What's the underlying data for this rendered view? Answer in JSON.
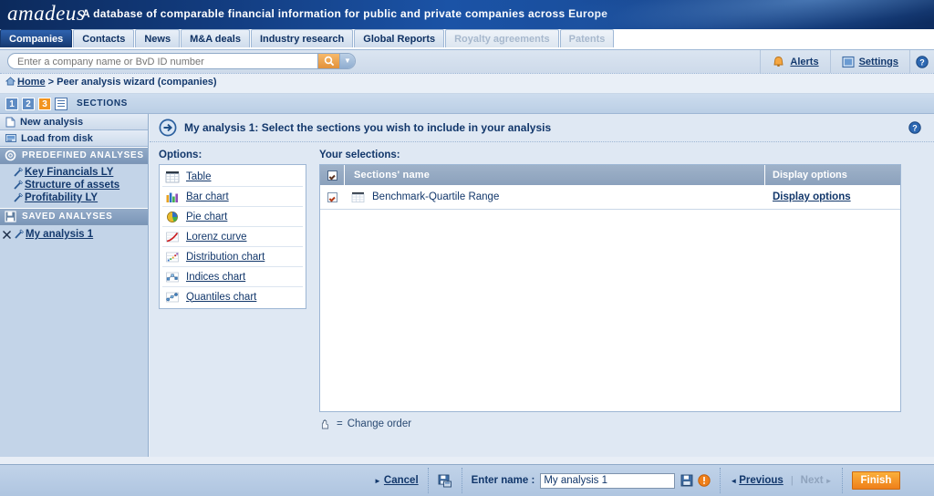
{
  "banner": {
    "logo": "amadeus",
    "tagline": "A database of comparable financial information for public and private companies across Europe"
  },
  "tabs": [
    {
      "label": "Companies",
      "state": "active"
    },
    {
      "label": "Contacts",
      "state": "normal"
    },
    {
      "label": "News",
      "state": "normal"
    },
    {
      "label": "M&A deals",
      "state": "normal"
    },
    {
      "label": "Industry research",
      "state": "normal"
    },
    {
      "label": "Global Reports",
      "state": "normal"
    },
    {
      "label": "Royalty agreements",
      "state": "disabled"
    },
    {
      "label": "Patents",
      "state": "disabled"
    }
  ],
  "search": {
    "placeholder": "Enter a company name or BvD ID number",
    "value": "",
    "go_icon": "search-icon",
    "caret_icon": "chevron-down-icon"
  },
  "topright": {
    "alerts_label": "Alerts",
    "alerts_icon": "bell-icon",
    "settings_label": "Settings",
    "settings_icon": "settings-icon",
    "help_icon": "help-icon"
  },
  "breadcrumb": {
    "home_icon": "home-icon",
    "home": "Home",
    "separator": ">",
    "current": "Peer analysis wizard (companies)"
  },
  "steps": {
    "items": [
      {
        "label": "1",
        "state": "done"
      },
      {
        "label": "2",
        "state": "done"
      },
      {
        "label": "3",
        "state": "current"
      }
    ],
    "doc_icon": "document-icon",
    "label": "SECTIONS"
  },
  "sidebar": {
    "buttons": [
      {
        "label": "New analysis",
        "icon": "page-icon"
      },
      {
        "label": "Load from disk",
        "icon": "disk-drive-icon"
      }
    ],
    "predefined": {
      "header": "PREDEFINED  ANALYSES",
      "icon": "gear-icon",
      "items": [
        {
          "label": "Key Financials LY",
          "icon": "wand-icon"
        },
        {
          "label": "Structure of assets",
          "icon": "wand-icon"
        },
        {
          "label": "Profitability LY",
          "icon": "wand-icon"
        }
      ]
    },
    "saved": {
      "header": "SAVED ANALYSES",
      "icon": "floppy-icon",
      "items": [
        {
          "label": "My analysis 1",
          "icon": "wand-icon",
          "delete_icon": "close-x-icon"
        }
      ]
    }
  },
  "main": {
    "title_icon": "arrow-right-circle-icon",
    "title": "My analysis 1: Select the sections you wish to include in your analysis",
    "help_icon": "help-icon",
    "options": {
      "label": "Options:",
      "items": [
        {
          "label": "Table",
          "icon": "table-icon"
        },
        {
          "label": "Bar chart",
          "icon": "bar-chart-icon"
        },
        {
          "label": "Pie chart",
          "icon": "pie-chart-icon"
        },
        {
          "label": "Lorenz curve",
          "icon": "lorenz-curve-icon"
        },
        {
          "label": "Distribution chart",
          "icon": "distribution-chart-icon"
        },
        {
          "label": "Indices chart",
          "icon": "indices-chart-icon"
        },
        {
          "label": "Quantiles chart",
          "icon": "quantiles-chart-icon"
        }
      ]
    },
    "selections": {
      "label": "Your selections:",
      "columns": {
        "name": "Sections' name",
        "display": "Display options"
      },
      "header_checked": true,
      "rows": [
        {
          "checked": true,
          "icon": "table-icon",
          "name": "Benchmark-Quartile Range",
          "display_link": "Display options"
        }
      ]
    },
    "legend": {
      "icon": "hand-icon",
      "equals": "=",
      "text": "Change order"
    }
  },
  "footer": {
    "cancel_label": "Cancel",
    "save_disk_icon": "save-to-disk-icon",
    "enter_name_label": "Enter name :",
    "name_value": "My analysis 1",
    "name_placeholder": "",
    "save_icon": "floppy-icon",
    "alert_icon": "alert-icon",
    "previous_label": "Previous",
    "next_label": "Next",
    "separator": "|",
    "finish_label": "Finish"
  },
  "colors": {
    "accent_orange": "#f2941f",
    "brand_blue": "#12376b",
    "tab_active": "#16396f",
    "panel_bg": "#dfe8f3",
    "sidebar_bg": "#c3d4e8"
  }
}
